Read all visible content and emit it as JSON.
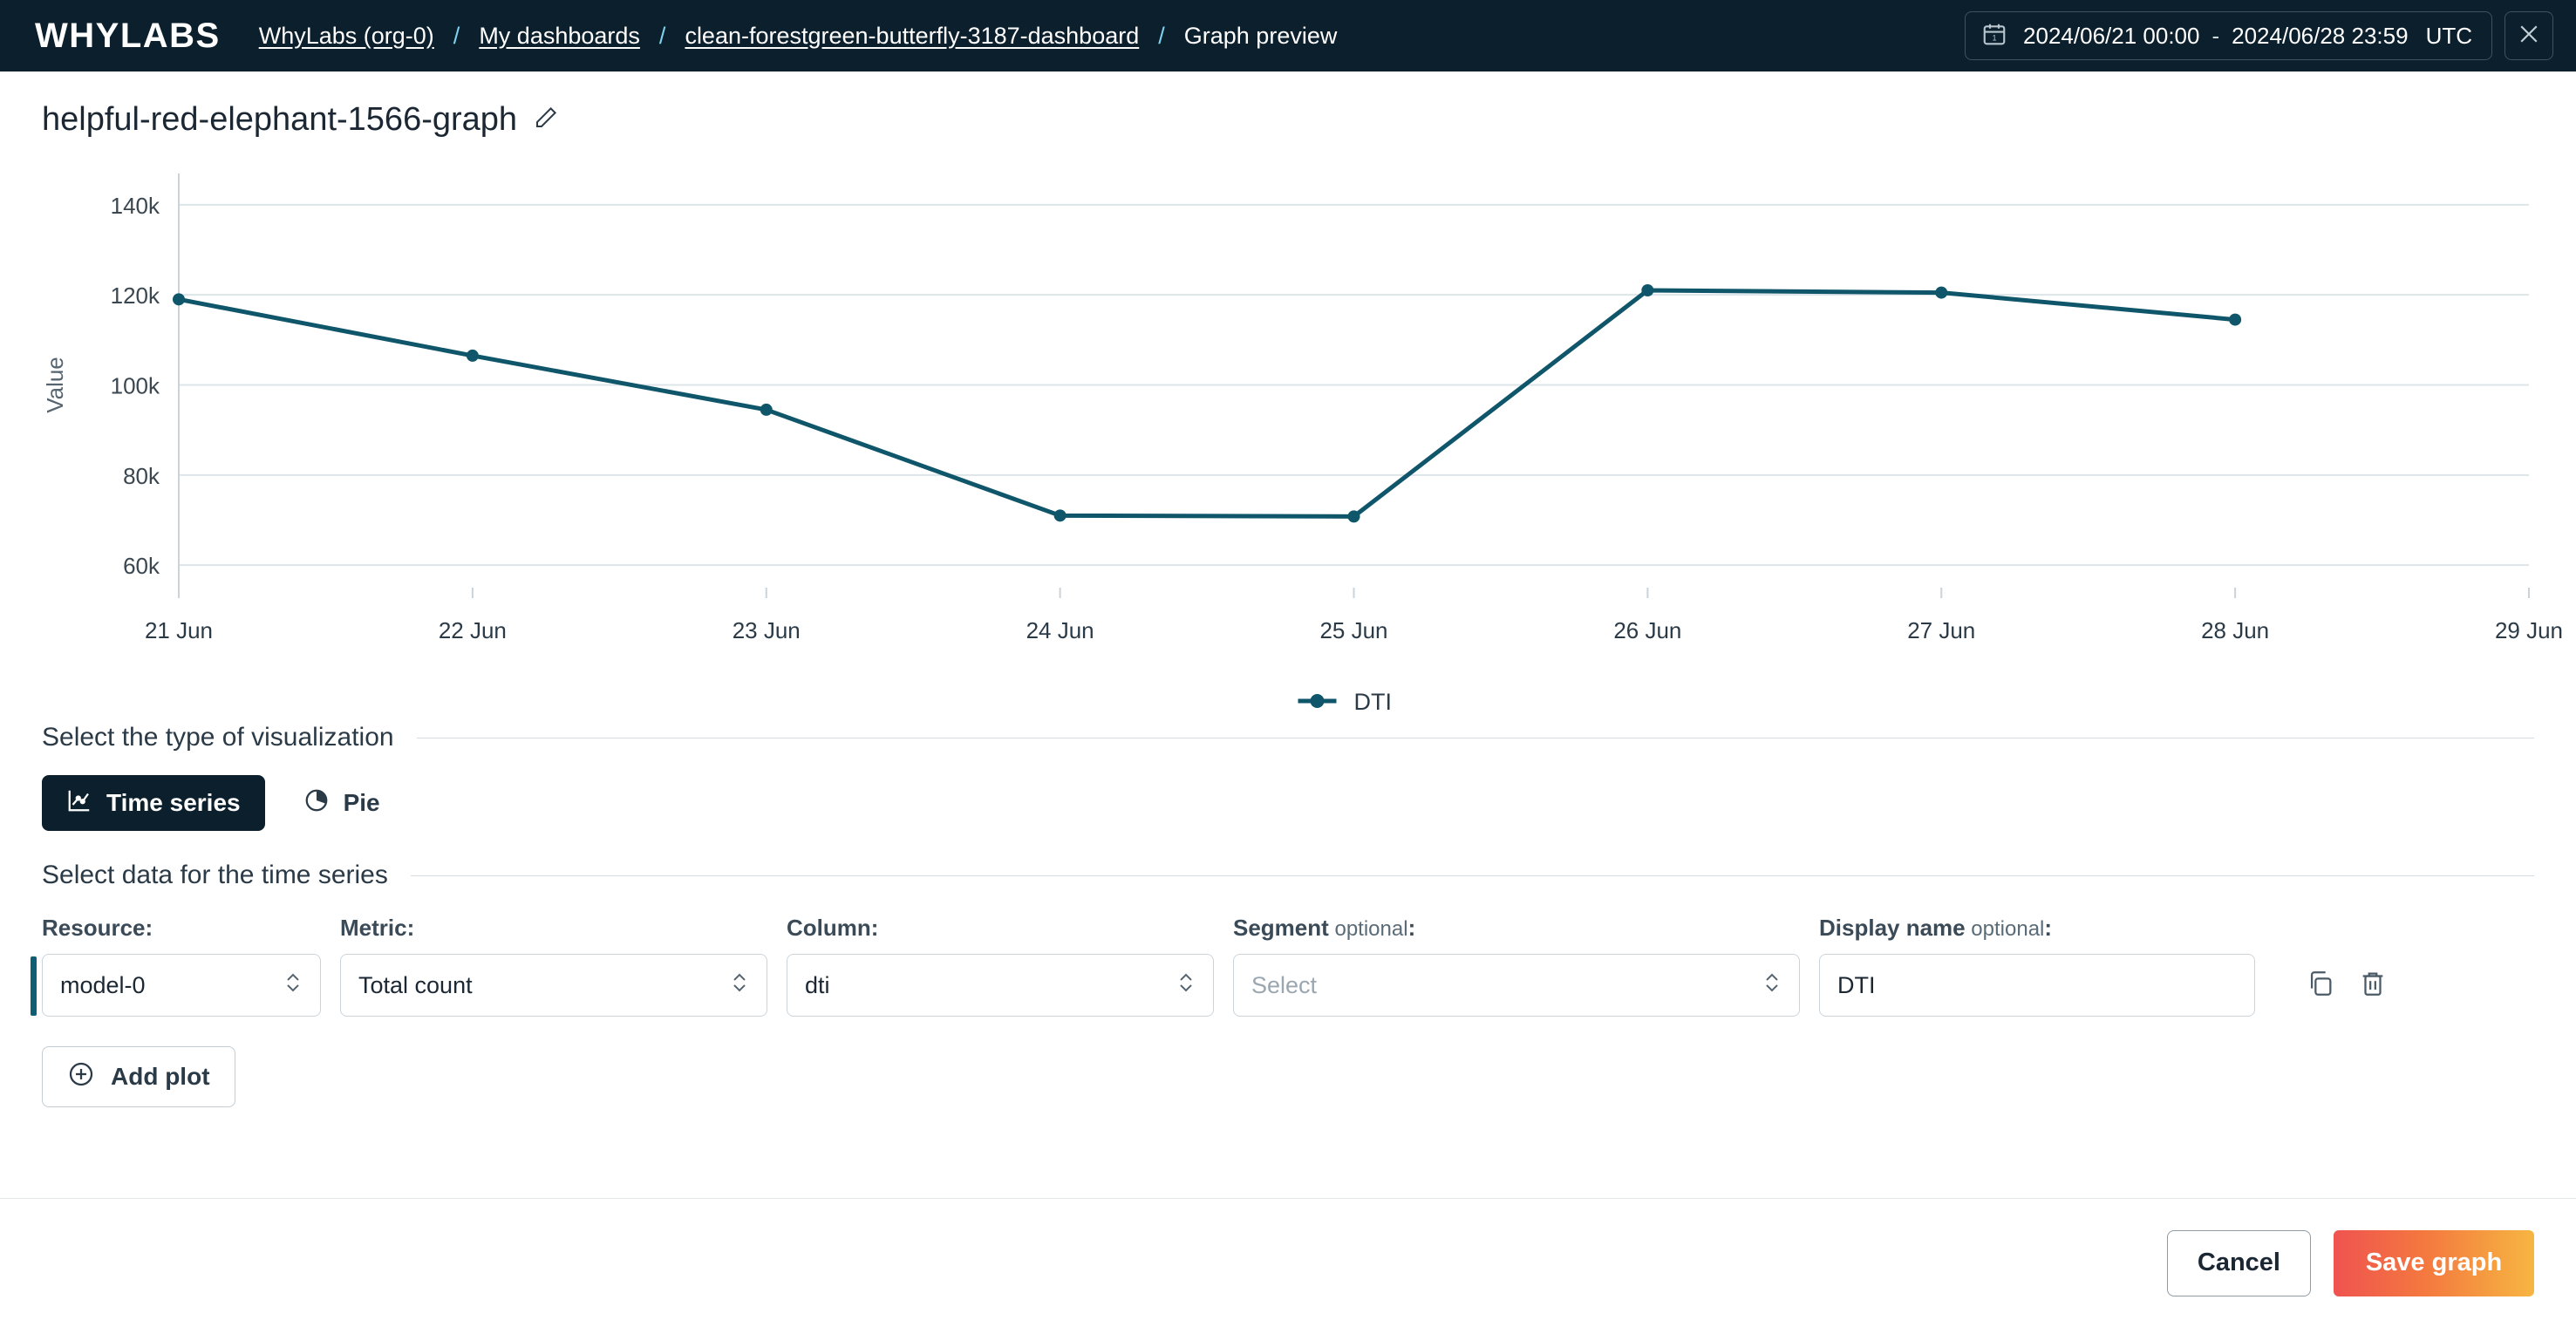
{
  "header": {
    "logo": "WHYLABS",
    "breadcrumbs": [
      {
        "label": "WhyLabs (org-0)",
        "link": true
      },
      {
        "label": "My dashboards",
        "link": true
      },
      {
        "label": "clean-forestgreen-butterfly-3187-dashboard",
        "link": true
      },
      {
        "label": "Graph preview",
        "link": false
      }
    ],
    "separator": "/",
    "date_range": {
      "icon": "calendar-icon",
      "start": "2024/06/21 00:00",
      "dash": "-",
      "end": "2024/06/28 23:59",
      "timezone": "UTC"
    },
    "close_icon": "close-icon"
  },
  "title": {
    "text": "helpful-red-elephant-1566-graph",
    "edit_icon": "pencil-icon"
  },
  "chart_data": {
    "type": "line",
    "title": "",
    "xlabel": "",
    "ylabel": "Value",
    "x": [
      "21 Jun",
      "22 Jun",
      "23 Jun",
      "24 Jun",
      "25 Jun",
      "26 Jun",
      "27 Jun",
      "28 Jun",
      "29 Jun"
    ],
    "xtick_labels": [
      "21 Jun",
      "22 Jun",
      "23 Jun",
      "24 Jun",
      "25 Jun",
      "26 Jun",
      "27 Jun",
      "28 Jun",
      "29 Jun"
    ],
    "ytick_labels": [
      "60k",
      "80k",
      "100k",
      "120k",
      "140k"
    ],
    "ytick_values": [
      60000,
      80000,
      100000,
      120000,
      140000
    ],
    "ylim": [
      55000,
      145000
    ],
    "grid": true,
    "legend_position": "bottom",
    "series": [
      {
        "name": "DTI",
        "color": "#10566b",
        "values": [
          119000,
          106500,
          94500,
          71000,
          70800,
          121000,
          120500,
          114500,
          null
        ]
      }
    ]
  },
  "viz_section": {
    "label": "Select the type of visualization",
    "options": [
      {
        "label": "Time series",
        "icon": "line-chart-icon",
        "active": true
      },
      {
        "label": "Pie",
        "icon": "pie-chart-icon",
        "active": false
      }
    ]
  },
  "data_section": {
    "label": "Select data for the time series",
    "fields": {
      "resource": {
        "label": "Resource:",
        "value": "model-0"
      },
      "metric": {
        "label": "Metric:",
        "value": "Total count"
      },
      "column": {
        "label": "Column:",
        "value": "dti"
      },
      "segment": {
        "label": "Segment",
        "optional": " optional",
        "colon": ":",
        "placeholder": "Select",
        "value": ""
      },
      "display_name": {
        "label": "Display name",
        "optional": " optional",
        "colon": ":",
        "value": "DTI"
      }
    },
    "row_actions": [
      {
        "icon": "copy-icon",
        "name": "duplicate-plot-button"
      },
      {
        "icon": "trash-icon",
        "name": "delete-plot-button"
      }
    ],
    "add_plot": {
      "label": "Add plot",
      "icon": "plus-circle-icon"
    }
  },
  "footer": {
    "cancel_label": "Cancel",
    "save_label": "Save graph"
  },
  "colors": {
    "header_bg": "#0b1f2c",
    "series": "#10566b",
    "accent_bar": "#0e5f73",
    "separator": "#7fd3ee",
    "save_gradient_start": "#ef5350",
    "save_gradient_end": "#f6b642"
  }
}
